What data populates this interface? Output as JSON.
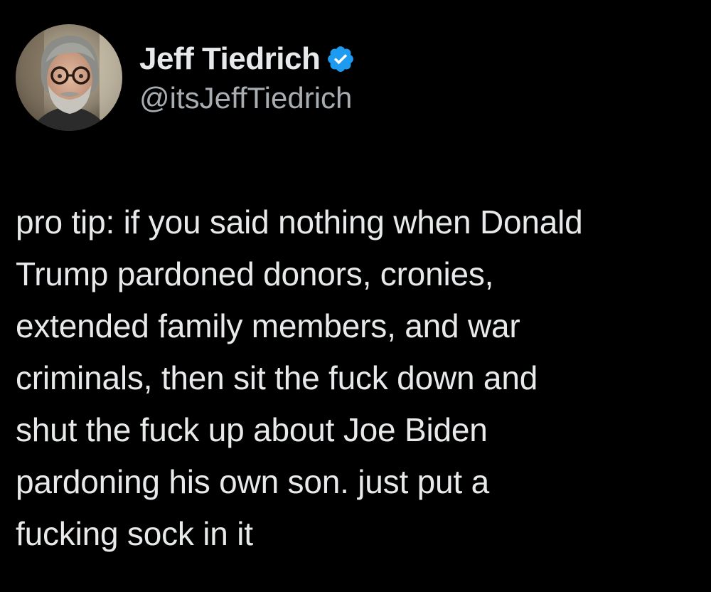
{
  "author": {
    "display_name": "Jeff Tiedrich",
    "handle": "@itsJeffTiedrich",
    "verified": true
  },
  "tweet": {
    "lines": [
      "pro tip: if you said nothing when Donald",
      "Trump pardoned donors, cronies,",
      "extended family members, and war",
      "criminals, then sit the fuck down and",
      "shut the fuck up about Joe Biden",
      "pardoning his own son. just put a",
      "fucking sock in it"
    ]
  },
  "colors": {
    "background": "#000000",
    "text": "#e7e9ea",
    "secondary_text": "#a8adb2",
    "verified_badge": "#1d9bf0"
  },
  "icons": {
    "avatar": "avatar-photo",
    "badge": "verified-badge-icon"
  }
}
